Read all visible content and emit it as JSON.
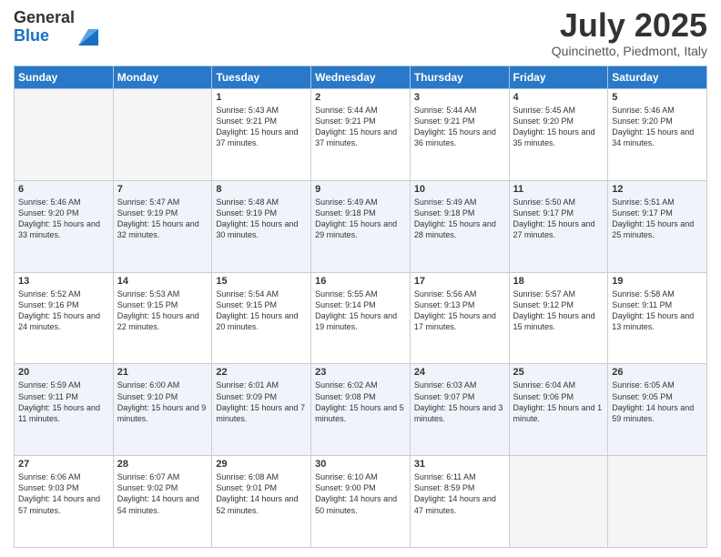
{
  "logo": {
    "general": "General",
    "blue": "Blue"
  },
  "title": "July 2025",
  "location": "Quincinetto, Piedmont, Italy",
  "days_of_week": [
    "Sunday",
    "Monday",
    "Tuesday",
    "Wednesday",
    "Thursday",
    "Friday",
    "Saturday"
  ],
  "weeks": [
    [
      {
        "day": "",
        "text": ""
      },
      {
        "day": "",
        "text": ""
      },
      {
        "day": "1",
        "text": "Sunrise: 5:43 AM\nSunset: 9:21 PM\nDaylight: 15 hours and 37 minutes."
      },
      {
        "day": "2",
        "text": "Sunrise: 5:44 AM\nSunset: 9:21 PM\nDaylight: 15 hours and 37 minutes."
      },
      {
        "day": "3",
        "text": "Sunrise: 5:44 AM\nSunset: 9:21 PM\nDaylight: 15 hours and 36 minutes."
      },
      {
        "day": "4",
        "text": "Sunrise: 5:45 AM\nSunset: 9:20 PM\nDaylight: 15 hours and 35 minutes."
      },
      {
        "day": "5",
        "text": "Sunrise: 5:46 AM\nSunset: 9:20 PM\nDaylight: 15 hours and 34 minutes."
      }
    ],
    [
      {
        "day": "6",
        "text": "Sunrise: 5:46 AM\nSunset: 9:20 PM\nDaylight: 15 hours and 33 minutes."
      },
      {
        "day": "7",
        "text": "Sunrise: 5:47 AM\nSunset: 9:19 PM\nDaylight: 15 hours and 32 minutes."
      },
      {
        "day": "8",
        "text": "Sunrise: 5:48 AM\nSunset: 9:19 PM\nDaylight: 15 hours and 30 minutes."
      },
      {
        "day": "9",
        "text": "Sunrise: 5:49 AM\nSunset: 9:18 PM\nDaylight: 15 hours and 29 minutes."
      },
      {
        "day": "10",
        "text": "Sunrise: 5:49 AM\nSunset: 9:18 PM\nDaylight: 15 hours and 28 minutes."
      },
      {
        "day": "11",
        "text": "Sunrise: 5:50 AM\nSunset: 9:17 PM\nDaylight: 15 hours and 27 minutes."
      },
      {
        "day": "12",
        "text": "Sunrise: 5:51 AM\nSunset: 9:17 PM\nDaylight: 15 hours and 25 minutes."
      }
    ],
    [
      {
        "day": "13",
        "text": "Sunrise: 5:52 AM\nSunset: 9:16 PM\nDaylight: 15 hours and 24 minutes."
      },
      {
        "day": "14",
        "text": "Sunrise: 5:53 AM\nSunset: 9:15 PM\nDaylight: 15 hours and 22 minutes."
      },
      {
        "day": "15",
        "text": "Sunrise: 5:54 AM\nSunset: 9:15 PM\nDaylight: 15 hours and 20 minutes."
      },
      {
        "day": "16",
        "text": "Sunrise: 5:55 AM\nSunset: 9:14 PM\nDaylight: 15 hours and 19 minutes."
      },
      {
        "day": "17",
        "text": "Sunrise: 5:56 AM\nSunset: 9:13 PM\nDaylight: 15 hours and 17 minutes."
      },
      {
        "day": "18",
        "text": "Sunrise: 5:57 AM\nSunset: 9:12 PM\nDaylight: 15 hours and 15 minutes."
      },
      {
        "day": "19",
        "text": "Sunrise: 5:58 AM\nSunset: 9:11 PM\nDaylight: 15 hours and 13 minutes."
      }
    ],
    [
      {
        "day": "20",
        "text": "Sunrise: 5:59 AM\nSunset: 9:11 PM\nDaylight: 15 hours and 11 minutes."
      },
      {
        "day": "21",
        "text": "Sunrise: 6:00 AM\nSunset: 9:10 PM\nDaylight: 15 hours and 9 minutes."
      },
      {
        "day": "22",
        "text": "Sunrise: 6:01 AM\nSunset: 9:09 PM\nDaylight: 15 hours and 7 minutes."
      },
      {
        "day": "23",
        "text": "Sunrise: 6:02 AM\nSunset: 9:08 PM\nDaylight: 15 hours and 5 minutes."
      },
      {
        "day": "24",
        "text": "Sunrise: 6:03 AM\nSunset: 9:07 PM\nDaylight: 15 hours and 3 minutes."
      },
      {
        "day": "25",
        "text": "Sunrise: 6:04 AM\nSunset: 9:06 PM\nDaylight: 15 hours and 1 minute."
      },
      {
        "day": "26",
        "text": "Sunrise: 6:05 AM\nSunset: 9:05 PM\nDaylight: 14 hours and 59 minutes."
      }
    ],
    [
      {
        "day": "27",
        "text": "Sunrise: 6:06 AM\nSunset: 9:03 PM\nDaylight: 14 hours and 57 minutes."
      },
      {
        "day": "28",
        "text": "Sunrise: 6:07 AM\nSunset: 9:02 PM\nDaylight: 14 hours and 54 minutes."
      },
      {
        "day": "29",
        "text": "Sunrise: 6:08 AM\nSunset: 9:01 PM\nDaylight: 14 hours and 52 minutes."
      },
      {
        "day": "30",
        "text": "Sunrise: 6:10 AM\nSunset: 9:00 PM\nDaylight: 14 hours and 50 minutes."
      },
      {
        "day": "31",
        "text": "Sunrise: 6:11 AM\nSunset: 8:59 PM\nDaylight: 14 hours and 47 minutes."
      },
      {
        "day": "",
        "text": ""
      },
      {
        "day": "",
        "text": ""
      }
    ]
  ]
}
